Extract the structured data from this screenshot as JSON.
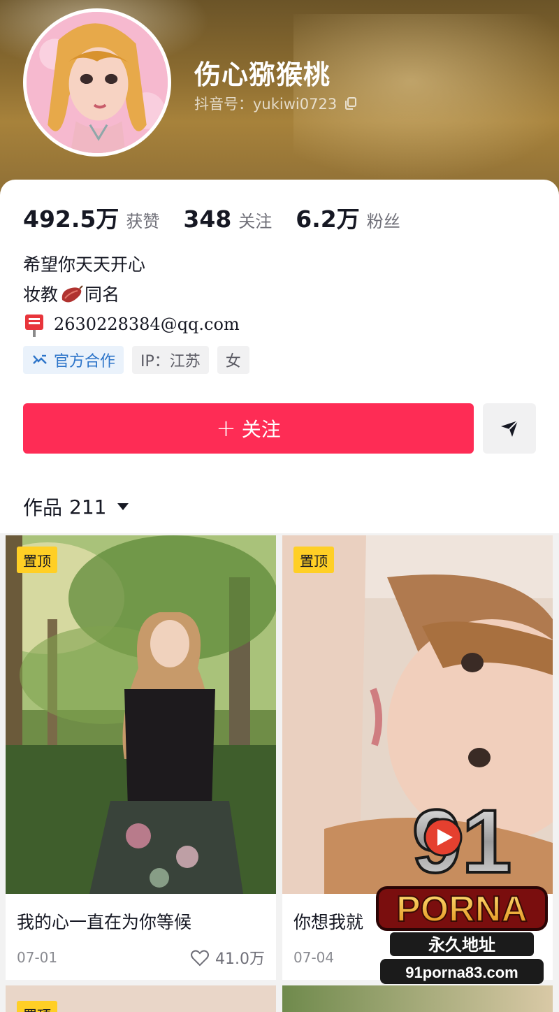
{
  "profile": {
    "nickname": "伤心猕猴桃",
    "douyin_id": "抖音号：yukiwi0723"
  },
  "stats": [
    {
      "value": "492.5万",
      "label": "获赞"
    },
    {
      "value": "348",
      "label": "关注"
    },
    {
      "value": "6.2万",
      "label": "粉丝"
    }
  ],
  "bio": {
    "line1": "希望你天天开心",
    "line2_prefix": "妆教",
    "line2_suffix": "同名",
    "email": "2630228384@qq.com"
  },
  "tags": {
    "cooperation": "官方合作",
    "ip": "IP：江苏",
    "gender": "女"
  },
  "actions": {
    "follow": "关注",
    "follow_plus": "+"
  },
  "works": {
    "label": "作品",
    "count": "211"
  },
  "videos": [
    {
      "pin": "置顶",
      "title": "我的心一直在为你等候",
      "date": "07-01",
      "likes": "41.0万"
    },
    {
      "pin": "置顶",
      "title": "你想我就",
      "date": "07-04",
      "likes": ""
    },
    {
      "pin": "置顶"
    },
    {
      "pin": ""
    }
  ],
  "watermark": {
    "number": "91",
    "brand": "PORNA",
    "slogan": "永久地址",
    "domain": "91porna83.com"
  },
  "colors": {
    "accent": "#fe2c55",
    "pin": "#ffcf25",
    "link": "#2c74c9"
  }
}
